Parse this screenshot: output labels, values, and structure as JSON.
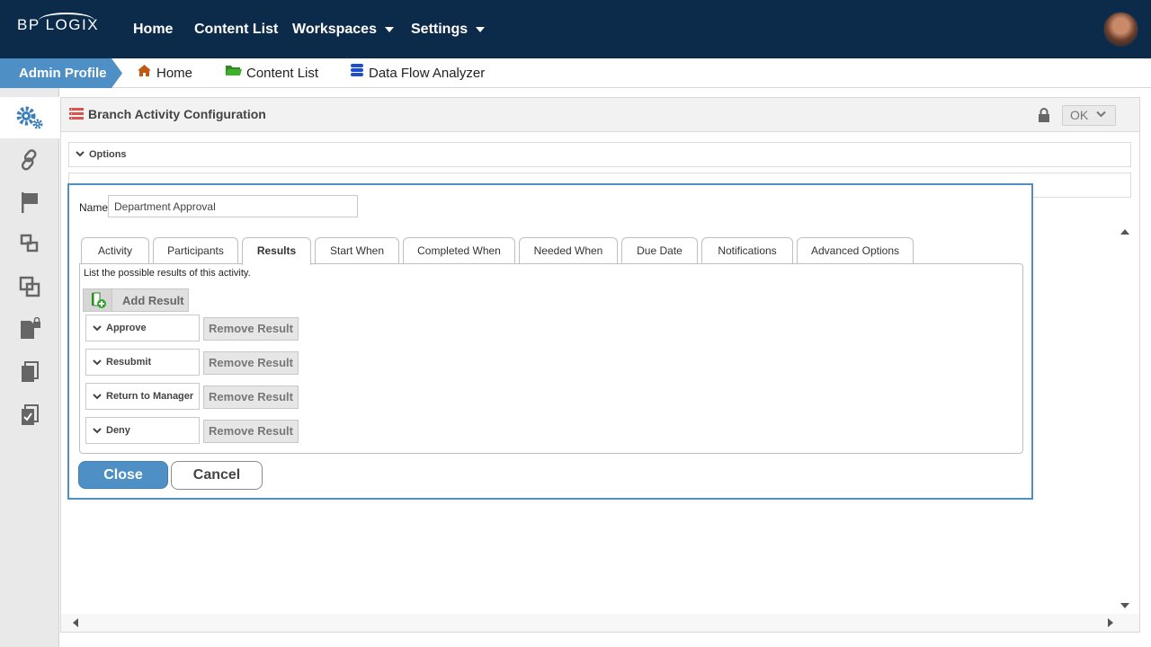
{
  "topbar": {
    "logo_text": "BP LOGIX",
    "nav": [
      {
        "label": "Home"
      },
      {
        "label": "Content List"
      },
      {
        "label": "Workspaces",
        "dropdown": true
      },
      {
        "label": "Settings",
        "dropdown": true
      }
    ]
  },
  "breadcrumb": {
    "current": "Admin Profile",
    "links": [
      {
        "label": "Home",
        "icon": "home-icon"
      },
      {
        "label": "Content List",
        "icon": "folder-icon"
      },
      {
        "label": "Data Flow Analyzer",
        "icon": "database-icon"
      }
    ]
  },
  "sidebar": {
    "items": [
      {
        "icon": "gears-icon",
        "active": true
      },
      {
        "icon": "link-icon"
      },
      {
        "icon": "flag-icon"
      },
      {
        "icon": "structure-icon"
      },
      {
        "icon": "overlap-squares-icon"
      },
      {
        "icon": "locked-document-icon"
      },
      {
        "icon": "copy-document-icon"
      },
      {
        "icon": "checked-document-icon"
      }
    ]
  },
  "panel": {
    "title": "Branch Activity Configuration",
    "ok_label": "OK",
    "options_label": "Options"
  },
  "dialog": {
    "name_label": "Name",
    "name_value": "Department Approval",
    "tabs": [
      {
        "label": "Activity"
      },
      {
        "label": "Participants"
      },
      {
        "label": "Results",
        "active": true
      },
      {
        "label": "Start When"
      },
      {
        "label": "Completed When"
      },
      {
        "label": "Needed When"
      },
      {
        "label": "Due Date"
      },
      {
        "label": "Notifications"
      },
      {
        "label": "Advanced Options"
      }
    ],
    "description": "List the possible results of this activity.",
    "add_result_label": "Add Result",
    "remove_label": "Remove Result",
    "results": [
      {
        "label": "Approve"
      },
      {
        "label": "Resubmit"
      },
      {
        "label": "Return to Manager"
      },
      {
        "label": "Deny"
      }
    ],
    "close_label": "Close",
    "cancel_label": "Cancel"
  },
  "colors": {
    "navbar": "#0c2a4a",
    "accent": "#4e90c6",
    "sidebar": "#e9e9e9"
  }
}
